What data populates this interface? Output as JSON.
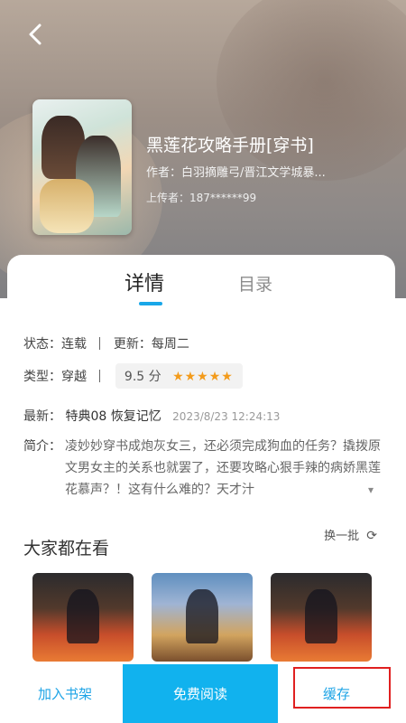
{
  "header": {
    "back_icon": "chevron-left-icon",
    "title": "黑莲花攻略手册[穿书]",
    "author": "作者：白羽摘雕弓/晋江文学城暴...",
    "uploader": "上传者：187******99"
  },
  "tabs": {
    "detail": "详情",
    "toc": "目录"
  },
  "info": {
    "status": "状态：连载",
    "update": "更新：每周二",
    "genre": "类型：穿越",
    "rating": "9.5 分",
    "stars": "★★★★★",
    "latest_label": "最新：",
    "latest_chapter": "特典08 恢复记忆",
    "latest_time": "2023/8/23 12:24:13",
    "intro_label": "简介：",
    "intro_text": "凌妙妙穿书成炮灰女三，还必须完成狗血的任务？撬拨原文男女主的关系也就罢了，还要攻略心狠手辣的病娇黑莲花慕声？！这有什么难的？天才汁",
    "expand_icon": "chevron-down-icon"
  },
  "recommend": {
    "title": "大家都在看",
    "refresh_label": "换一批",
    "refresh_icon": "refresh-icon"
  },
  "bottom_bar": {
    "add_shelf": "加入书架",
    "free_read": "免费阅读",
    "cache": "缓存"
  },
  "colors": {
    "accent": "#11b2ee",
    "star": "#f39b1b",
    "highlight": "#e02020"
  }
}
